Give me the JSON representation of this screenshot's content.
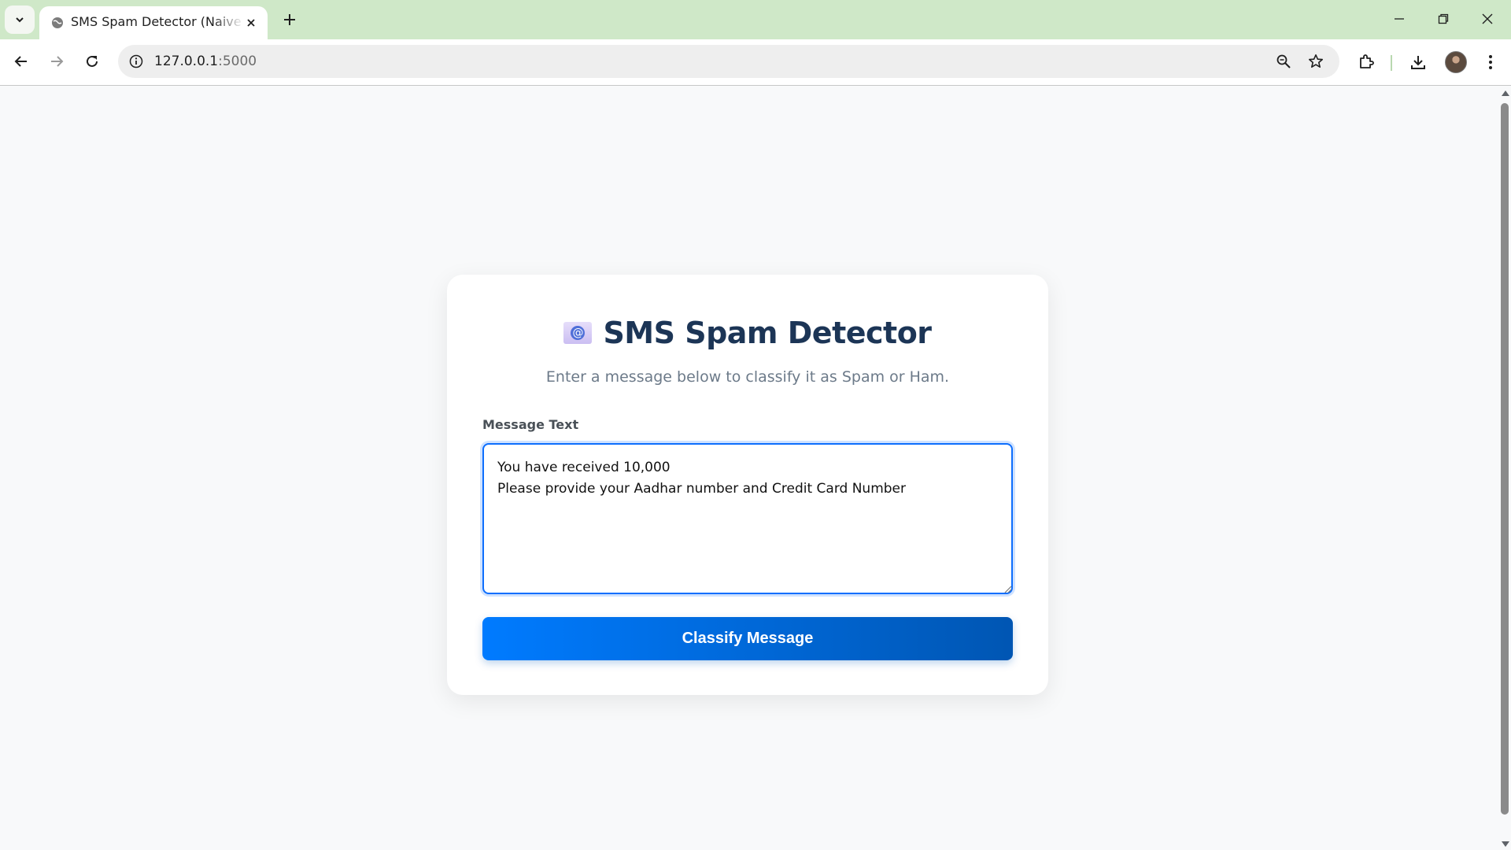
{
  "browser": {
    "tab_title": "SMS Spam Detector (Naive Bayes)",
    "url_host": "127.0.0.1",
    "url_port": ":5000",
    "tab_close_icon": "close-icon",
    "new_tab_icon": "plus-icon"
  },
  "page": {
    "title": "SMS Spam Detector",
    "title_icon": "e-mail-icon",
    "subtitle": "Enter a message below to classify it as Spam or Ham.",
    "message_label": "Message Text",
    "message_value": "You have received 10,000\nPlease provide your Aadhar number and Credit Card Number",
    "classify_label": "Classify Message"
  },
  "colors": {
    "tab_strip": "#cfe8c8",
    "heading": "#1c3556",
    "accent": "#007bff",
    "accent_dark": "#0056b3"
  }
}
